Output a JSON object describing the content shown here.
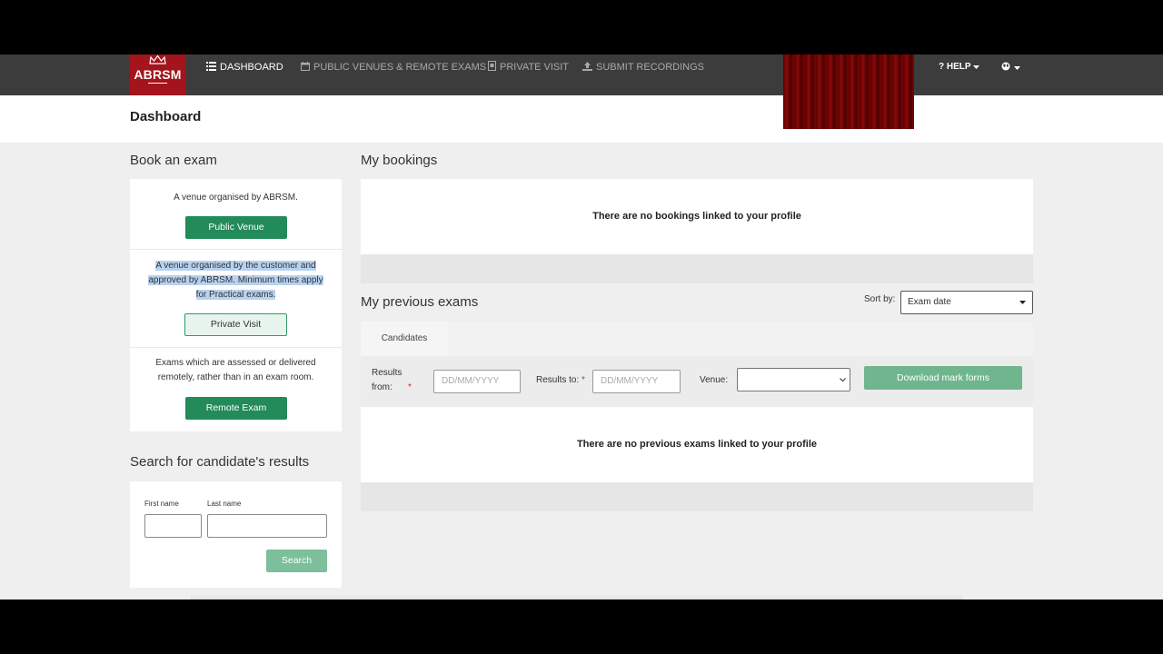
{
  "nav": {
    "logo_text": "ABRSM",
    "items": [
      {
        "label": "DASHBOARD",
        "icon": "list-icon"
      },
      {
        "label": "PUBLIC VENUES & REMOTE EXAMS",
        "icon": "calendar-icon"
      },
      {
        "label": "PRIVATE VISIT",
        "icon": "document-icon"
      },
      {
        "label": "SUBMIT RECORDINGS",
        "icon": "upload-icon"
      }
    ],
    "help": "HELP",
    "help_icon": "question-icon",
    "language_icon": "globe-icon"
  },
  "header": {
    "title": "Dashboard"
  },
  "book": {
    "title": "Book an exam",
    "options": [
      {
        "desc": "A venue organised by ABRSM.",
        "button": "Public Venue"
      },
      {
        "desc": "A venue organised by the customer and approved by ABRSM. Minimum times apply for Practical exams.",
        "button": "Private Visit"
      },
      {
        "desc": "Exams which are assessed or delivered remotely, rather than in an exam room.",
        "button": "Remote Exam"
      }
    ]
  },
  "search": {
    "title": "Search for candidate's results",
    "first_name_label": "First name",
    "last_name_label": "Last name",
    "button": "Search"
  },
  "bookings": {
    "title": "My bookings",
    "empty_message": "There are no bookings linked to your profile"
  },
  "previous": {
    "title": "My previous exams",
    "sort_label": "Sort by:",
    "sort_value": "Exam date",
    "tab": "Candidates",
    "results_from_label": "Results from:",
    "results_to_label": "Results to:",
    "date_placeholder": "DD/MM/YYYY",
    "venue_label": "Venue:",
    "download_button": "Download mark forms",
    "empty_message": "There are no previous exams linked to your profile"
  },
  "colors": {
    "brand": "#a3141c",
    "nav_bg": "#3c3c3c",
    "accent_green": "#238a5a"
  }
}
